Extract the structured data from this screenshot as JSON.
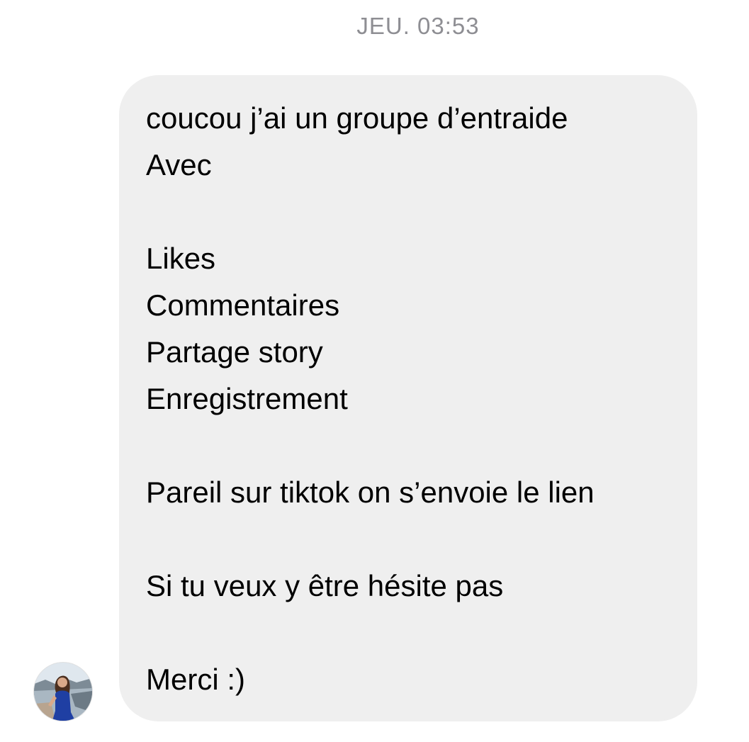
{
  "conversation": {
    "timestamp": "JEU. 03:53",
    "message": {
      "lines": [
        "coucou j’ai un groupe d’entraide",
        "Avec",
        "Likes",
        "Commentaires",
        "Partage story",
        "Enregistrement",
        "Pareil sur tiktok on s’envoie le lien",
        "Si tu veux y être hésite pas",
        "Merci :)"
      ]
    },
    "sender": {
      "avatar_icon": "profile-photo"
    }
  },
  "colors": {
    "bubble_background": "#efefef",
    "timestamp_text": "#8e8e93",
    "message_text": "#000000",
    "page_background": "#ffffff"
  }
}
